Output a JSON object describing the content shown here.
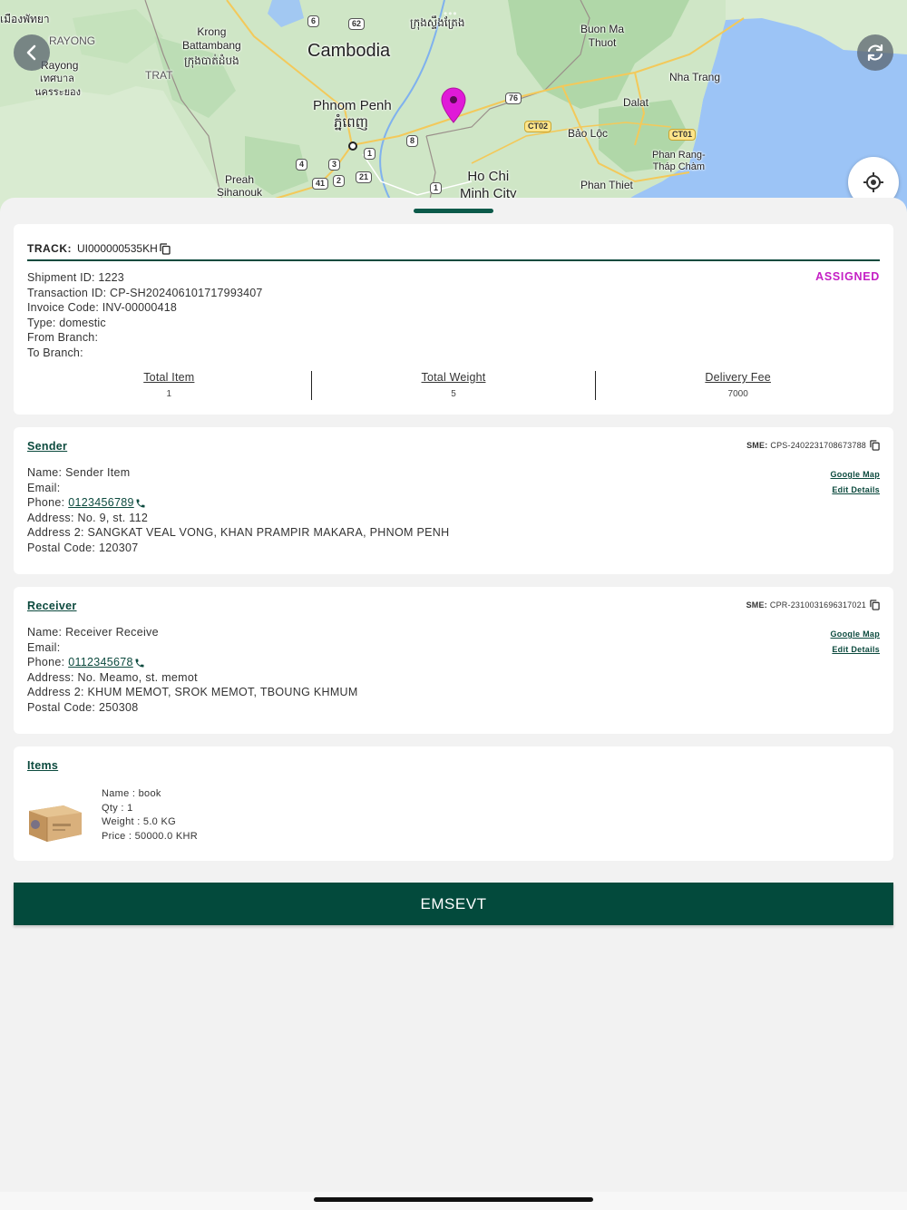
{
  "map": {
    "labels": {
      "cambodia": "Cambodia",
      "krong_battambang": "Krong\nBattambang",
      "battambang_khmer": "ក្រុងបាត់ដំបង",
      "rayong": "RAYONG",
      "rayong_city": "Rayong",
      "rayong_thai1": "เทศบาล",
      "rayong_thai2": "นครระยอง",
      "trat": "TRAT",
      "phnom_penh": "Phnom Penh",
      "phnom_penh_khmer": "ភ្នំពេញ",
      "preah_sihanouk": "Preah\nSihanouk",
      "ho_chi_minh": "Ho Chi\nMinh City",
      "buon_ma_thuot": "Buon Ma\nThuot",
      "nha_trang": "Nha Trang",
      "dalat": "Dalat",
      "bao_loc": "Bảo Lộc",
      "phan_rang": "Phan Rang-\nTháp Chàm",
      "phan_thiet": "Phan Thiet",
      "top_left_thai": "เมืองพัทยา",
      "top_khmer": "ក្រុងស្ទឹងត្រែង"
    },
    "shields": [
      "62",
      "6",
      "76",
      "CT02",
      "CT01",
      "8",
      "1",
      "4",
      "3",
      "2",
      "41",
      "21",
      "1"
    ],
    "pin_color": "#e01ad8"
  },
  "track": {
    "label": "TRACK:",
    "number": "UI000000535KH",
    "status": "ASSIGNED",
    "lines": [
      "Shipment ID: 1223",
      "Transaction ID: CP-SH202406101717993407",
      "Invoice Code: INV-00000418",
      "Type: domestic",
      "From Branch:",
      "To Branch:"
    ],
    "stats": [
      {
        "label": "Total Item",
        "value": "1"
      },
      {
        "label": "Total Weight",
        "value": "5"
      },
      {
        "label": "Delivery Fee",
        "value": "7000"
      }
    ]
  },
  "sender": {
    "title": "Sender",
    "sme_label": "SME:",
    "sme_value": "CPS-2402231708673788",
    "name_line": "Name: Sender Item",
    "email_line": "Email:",
    "phone_prefix": "Phone: ",
    "phone": "0123456789",
    "address_line": "Address: No. 9, st. 112",
    "address2_line": "Address 2: SANGKAT VEAL VONG, KHAN PRAMPIR MAKARA, PHNOM PENH",
    "postal_line": "Postal Code: 120307",
    "google_map": "Google Map",
    "edit_details": "Edit Details"
  },
  "receiver": {
    "title": "Receiver",
    "sme_label": "SME:",
    "sme_value": "CPR-2310031696317021",
    "name_line": "Name: Receiver Receive",
    "email_line": "Email:",
    "phone_prefix": "Phone: ",
    "phone": "0112345678",
    "address_line": "Address: No. Meamo, st. memot",
    "address2_line": "Address 2: KHUM MEMOT, SROK MEMOT, TBOUNG KHMUM",
    "postal_line": "Postal Code: 250308",
    "google_map": "Google Map",
    "edit_details": "Edit Details"
  },
  "items": {
    "title": "Items",
    "list": [
      {
        "name_line": "Name : book",
        "qty_line": "Qty : 1",
        "weight_line": "Weight : 5.0 KG",
        "price_line": "Price : 50000.0 KHR"
      }
    ]
  },
  "action_button": {
    "label": "EMSEVT"
  },
  "colors": {
    "primary": "#034a3c",
    "status": "#c41fc4",
    "background": "#f2f2f2"
  }
}
